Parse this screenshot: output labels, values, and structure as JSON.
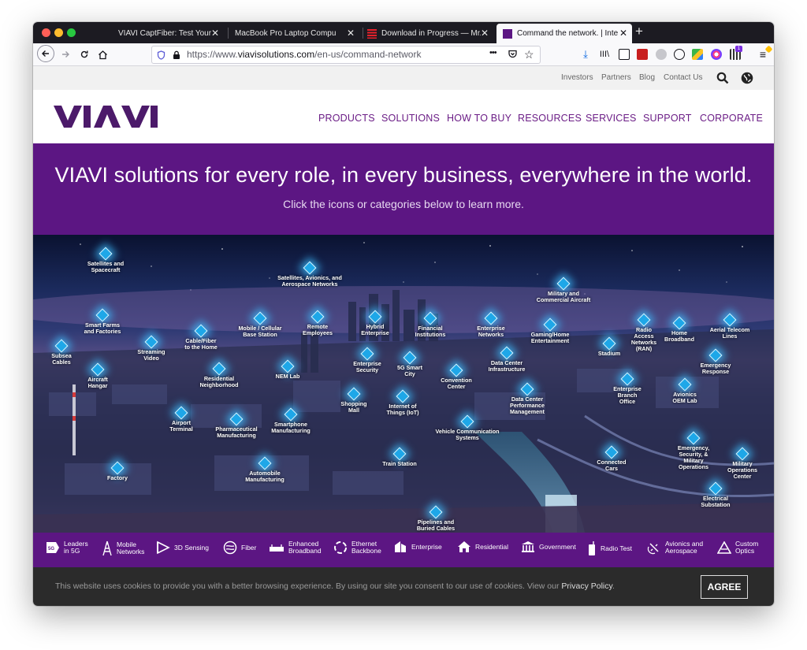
{
  "browser": {
    "tabs": [
      {
        "label": "VIAVI CaptFiber: Test Your Skill",
        "active": false
      },
      {
        "label": "MacBook Pro Laptop Computer & F",
        "active": false
      },
      {
        "label": "Download in Progress — Mr.Mc",
        "active": false
      },
      {
        "label": "Command the network. | Interac",
        "active": true
      }
    ],
    "url_prefix": "https://www.",
    "url_domain": "viavisolutions.com",
    "url_path": "/en-us/command-network",
    "more_label": "•••"
  },
  "site": {
    "utility_links": [
      "Investors",
      "Partners",
      "Blog",
      "Contact Us"
    ],
    "logo": "VIAVI",
    "nav": [
      "PRODUCTS",
      "SOLUTIONS",
      "HOW TO BUY",
      "RESOURCES",
      "SERVICES",
      "SUPPORT",
      "CORPORATE"
    ],
    "hero_title": "VIAVI solutions for every role, in every business, everywhere in the world.",
    "hero_subtitle": "Click the icons or categories below to learn more.",
    "hotspots": [
      "Satellites and\nSpacecraft",
      "Satellites, Avionics, and\nAerospace Networks",
      "Military and\nCommercial Aircraft",
      "Smart Farms\nand Factories",
      "Mobile / Cellular\nBase Station",
      "Remote\nEmployees",
      "Hybrid\nEnterprise",
      "Financial\nInstitutions",
      "Enterprise\nNetworks",
      "Gaming/Home\nEntertainment",
      "Radio\nAccess\nNetworks\n(RAN)",
      "Home\nBroadband",
      "Aerial Telecom\nLines",
      "Subsea\nCables",
      "Streaming\nVideo",
      "Cable/Fiber\nto the Home",
      "Enterprise\nSecurity",
      "5G Smart\nCity",
      "Data Center\nInfrastructure",
      "Stadium",
      "Emergency\nResponse",
      "Aircraft\nHangar",
      "Residential\nNeighborhood",
      "NEM Lab",
      "Convention\nCenter",
      "Enterprise\nBranch\nOffice",
      "Avionics\nOEM Lab",
      "Shopping\nMall",
      "Internet of\nThings (IoT)",
      "Data Center\nPerformance\nManagement",
      "Airport\nTerminal",
      "Pharmaceutical\nManufacturing",
      "Smartphone\nManufacturing",
      "Vehicle Communication\nSystems",
      "Emergency,\nSecurity, &\nMilitary\nOperations",
      "Connected\nCars",
      "Military\nOperations\nCenter",
      "Automobile\nManufacturing",
      "Train Station",
      "Factory",
      "Electrical\nSubstation",
      "Pipelines and\nBuried Cables"
    ],
    "categories": [
      "Leaders\nin 5G",
      "Mobile\nNetworks",
      "3D Sensing",
      "Fiber",
      "Enhanced\nBroadband",
      "Ethernet\nBackbone",
      "Enterprise",
      "Residential",
      "Government",
      "Radio Test",
      "Avionics and\nAerospace",
      "Custom\nOptics"
    ],
    "cookie_text": "This website uses cookies to provide you with a better browsing experience. By using our site you consent to our use of cookies. View our",
    "privacy_link": "Privacy Policy",
    "cookie_tail": ".",
    "agree_label": "AGREE"
  }
}
